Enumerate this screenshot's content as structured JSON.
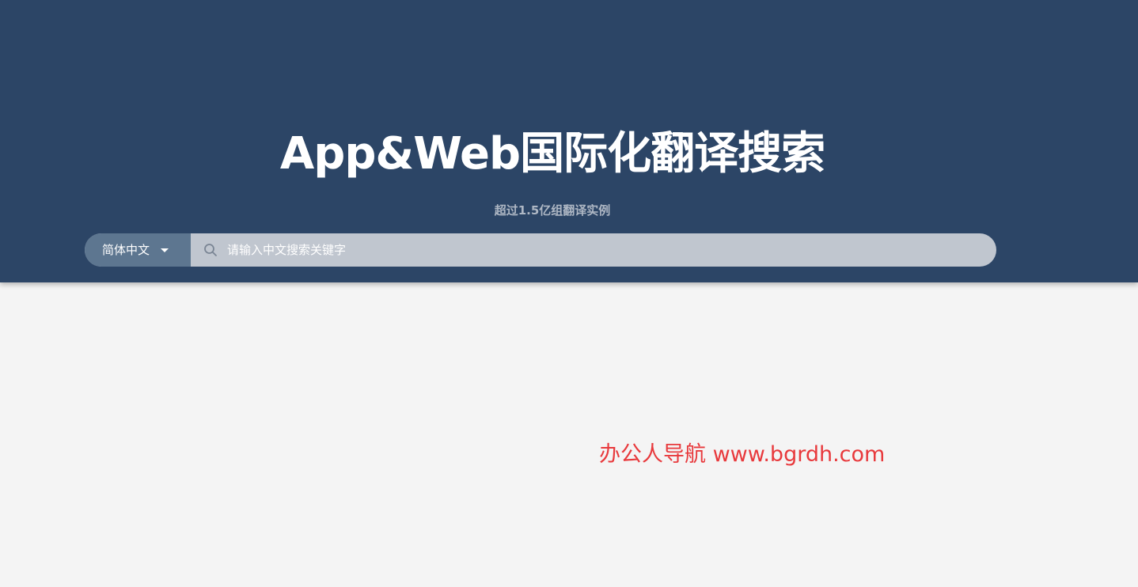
{
  "header": {
    "title": "App&Web国际化翻译搜索",
    "subtitle": "超过1.5亿组翻译实例"
  },
  "search": {
    "language": "简体中文",
    "placeholder": "请输入中文搜索关键字",
    "value": ""
  },
  "icons": {
    "search": "search-icon",
    "dropdown": "chevron-down-icon"
  },
  "colors": {
    "header_bg": "#2c4566",
    "lang_select_bg": "#5d7690",
    "input_bg": "#c0c6cf",
    "page_bg": "#f4f4f4",
    "watermark": "#e8393c"
  },
  "watermark": "办公人导航 www.bgrdh.com"
}
